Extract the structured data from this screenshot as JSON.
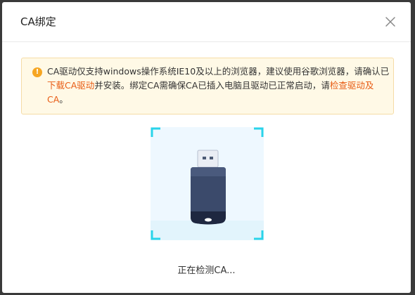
{
  "dialog": {
    "title": "CA绑定",
    "close_icon": "close-icon"
  },
  "notice": {
    "icon": "warning-icon",
    "icon_glyph": "!",
    "text_1": "CA驱动仅支持windows操作系统IE10及以上的浏览器，建议使用谷歌浏览器，请确认已",
    "link_download": "下载CA驱动",
    "text_2": "并安装。绑定CA需确保CA已插入电脑且驱动已正常启动，请",
    "link_check": "检查驱动及CA",
    "text_3": "。",
    "bg_color": "#fff9e6",
    "link_color": "#e85c14"
  },
  "scanner": {
    "icon": "usb-key-icon",
    "corner_color": "#2ad4ea"
  },
  "status": {
    "text": "正在检测CA..."
  }
}
